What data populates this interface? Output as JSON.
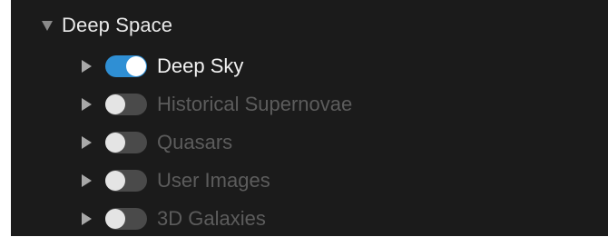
{
  "group": {
    "title": "Deep Space",
    "expanded": true
  },
  "layers": [
    {
      "label": "Deep Sky",
      "enabled": true
    },
    {
      "label": "Historical Supernovae",
      "enabled": false
    },
    {
      "label": "Quasars",
      "enabled": false
    },
    {
      "label": "User Images",
      "enabled": false
    },
    {
      "label": "3D Galaxies",
      "enabled": false
    }
  ],
  "colors": {
    "panel_background": "#1b1b1b",
    "toggle_on": "#2f8fd4",
    "toggle_off": "#4a4a4a",
    "label_enabled": "#f2f2f2",
    "label_disabled": "#5c5c5c"
  },
  "icons": {
    "expand": "caret-down-icon",
    "collapse": "caret-right-icon"
  }
}
